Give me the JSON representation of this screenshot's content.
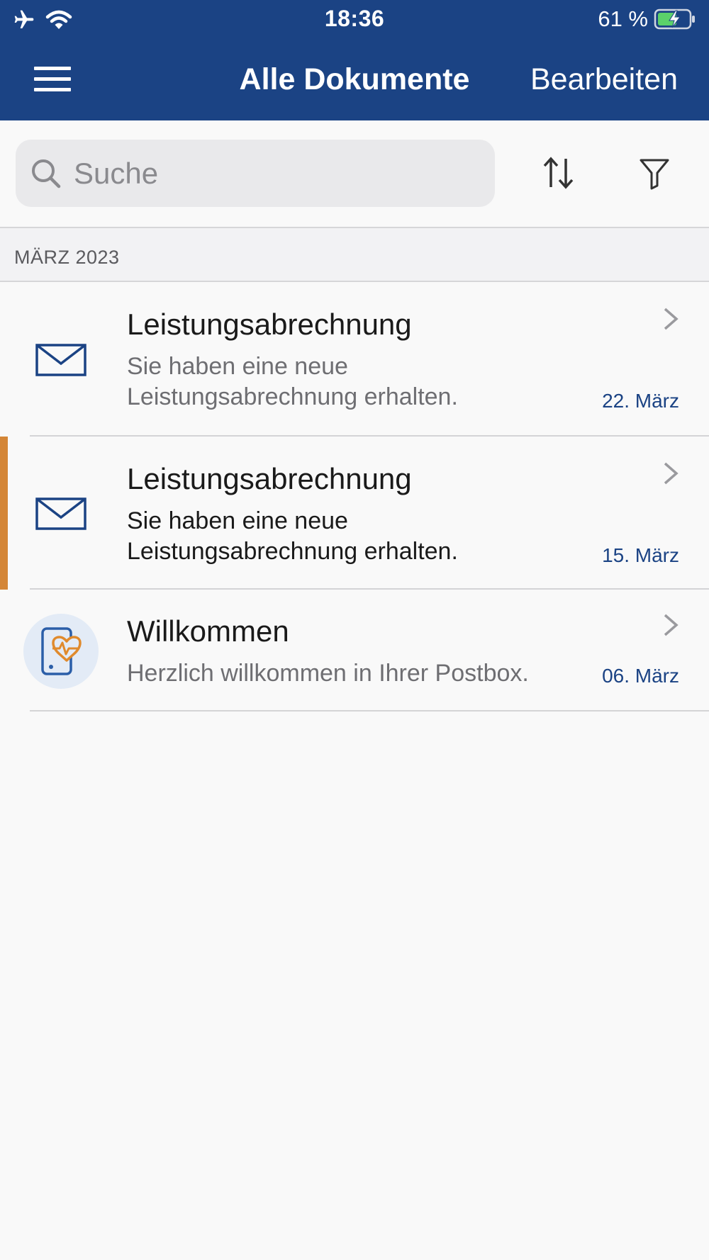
{
  "status": {
    "time": "18:36",
    "battery": "61 %"
  },
  "nav": {
    "title": "Alle Dokumente",
    "edit_label": "Bearbeiten"
  },
  "search": {
    "placeholder": "Suche"
  },
  "section": {
    "label": "MÄRZ 2023"
  },
  "items": [
    {
      "title": "Leistungsabrechnung",
      "subtitle_line1": "Sie haben eine neue",
      "subtitle_line2": "Leistungsabrechnung erhalten.",
      "date": "22. März",
      "icon": "envelope-icon",
      "unread": false
    },
    {
      "title": "Leistungsabrechnung",
      "subtitle_line1": "Sie haben eine neue",
      "subtitle_line2": "Leistungsabrechnung erhalten.",
      "date": "15. März",
      "icon": "envelope-icon",
      "unread": true
    },
    {
      "title": "Willkommen",
      "subtitle_line1": "Herzlich willkommen in Ihrer Postbox.",
      "date": "06. März",
      "icon": "phone-heart-icon",
      "unread": false
    }
  ],
  "colors": {
    "header": "#1b4384",
    "accent_unread": "#d48637",
    "date": "#1b4384"
  }
}
